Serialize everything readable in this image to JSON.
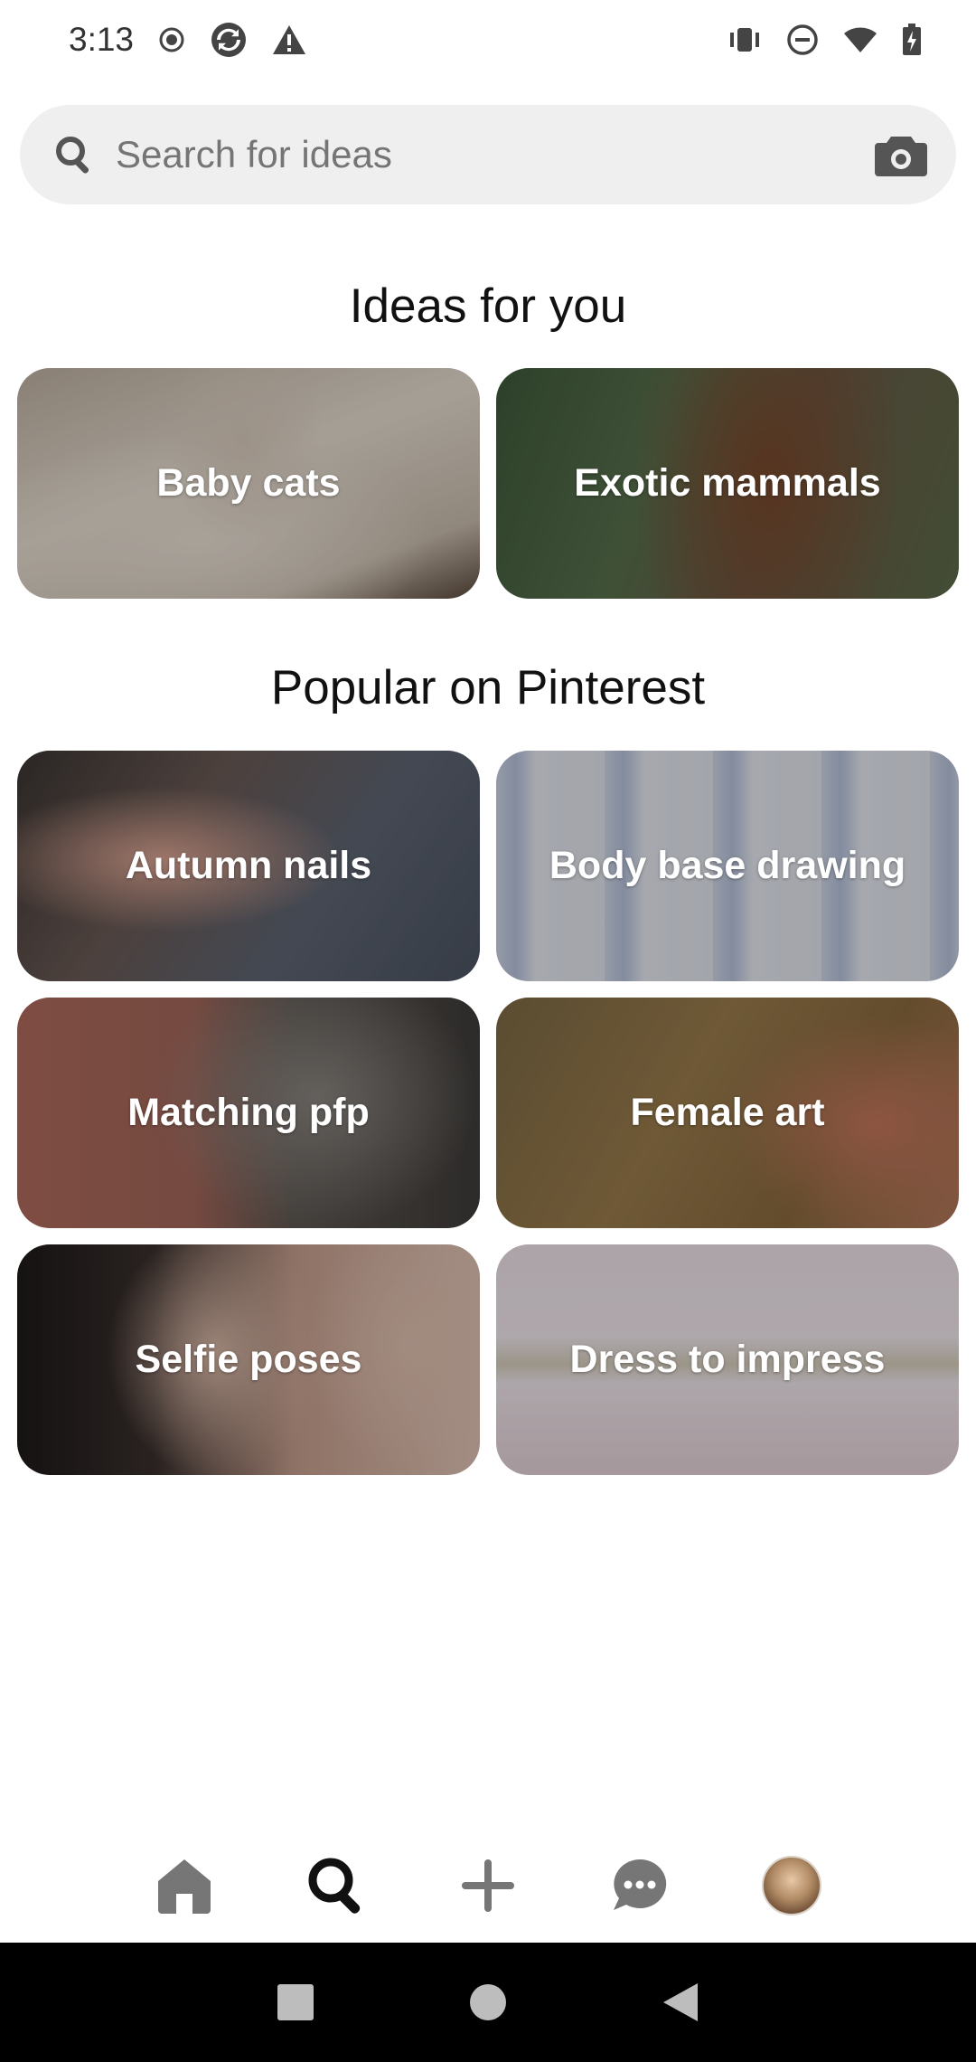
{
  "status_bar": {
    "time": "3:13",
    "left_icons": [
      "record-icon",
      "sync-icon",
      "warning-icon"
    ],
    "right_icons": [
      "vibrate-icon",
      "do-not-disturb-icon",
      "wifi-icon",
      "battery-icon"
    ]
  },
  "search": {
    "placeholder": "Search for ideas",
    "icon": "search-icon",
    "camera_icon": "camera-icon"
  },
  "ideas_section": {
    "title": "Ideas for you",
    "tiles": [
      {
        "label": "Baby cats"
      },
      {
        "label": "Exotic mammals"
      }
    ]
  },
  "popular_section": {
    "title": "Popular on Pinterest",
    "tiles": [
      {
        "label": "Autumn nails"
      },
      {
        "label": "Body base drawing"
      },
      {
        "label": "Matching pfp"
      },
      {
        "label": "Female art"
      },
      {
        "label": "Selfie poses"
      },
      {
        "label": "Dress to impress"
      }
    ]
  },
  "bottom_nav": {
    "items": [
      "home-icon",
      "search-icon",
      "plus-icon",
      "messages-icon",
      "profile-avatar"
    ],
    "active": "search-icon"
  },
  "system_nav": [
    "recents-button",
    "home-button",
    "back-button"
  ]
}
